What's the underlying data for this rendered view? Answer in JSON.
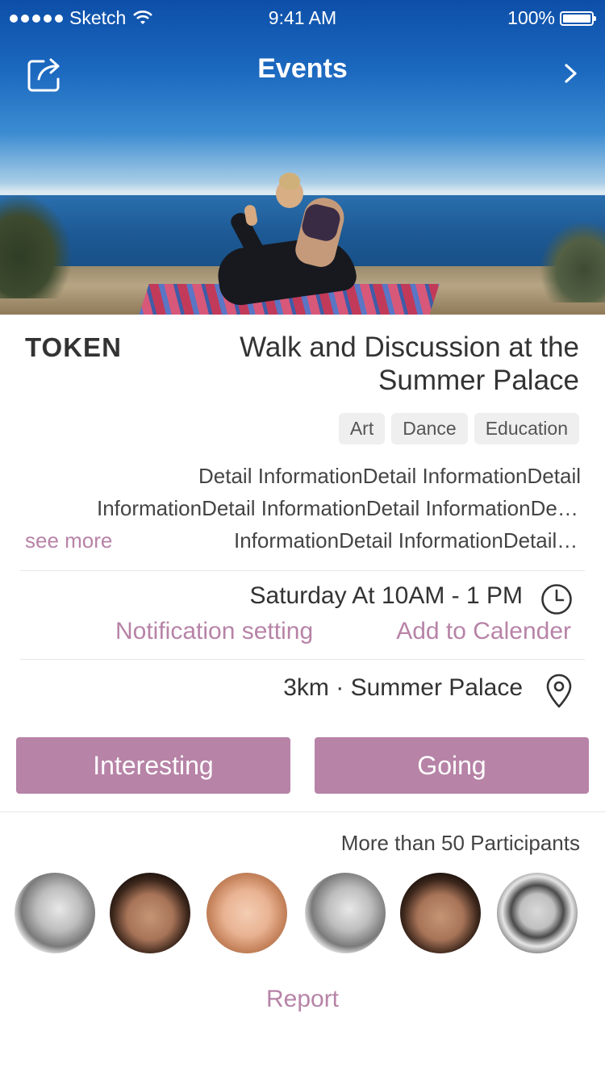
{
  "status_bar": {
    "carrier": "Sketch",
    "time": "9:41 AM",
    "battery": "100%"
  },
  "nav": {
    "title": "Events",
    "share_icon": "share-icon",
    "next_icon": "chevron-right-icon"
  },
  "event": {
    "organizer": "TOKEN",
    "title": "Walk and Discussion at the Summer Palace",
    "tags": [
      "Art",
      "Dance",
      "Education"
    ],
    "detail_lines": [
      "Detail InformationDetail InformationDetail",
      "InformationDetail InformationDetail InformationDetail",
      "InformationDetail InformationDetail Inf..."
    ],
    "see_more": "see more",
    "time": "Saturday At 10AM - 1 PM",
    "notification_setting": "Notification setting",
    "add_to_calendar": "Add to Calender",
    "location": "3km · Summer Palace"
  },
  "actions": {
    "interesting": "Interesting",
    "going": "Going"
  },
  "participants": {
    "label": "More than 50 Participants",
    "count_avatars": 6
  },
  "report": "Report",
  "colors": {
    "accent": "#b783a7",
    "tag_bg": "#efefef",
    "text": "#333333"
  }
}
